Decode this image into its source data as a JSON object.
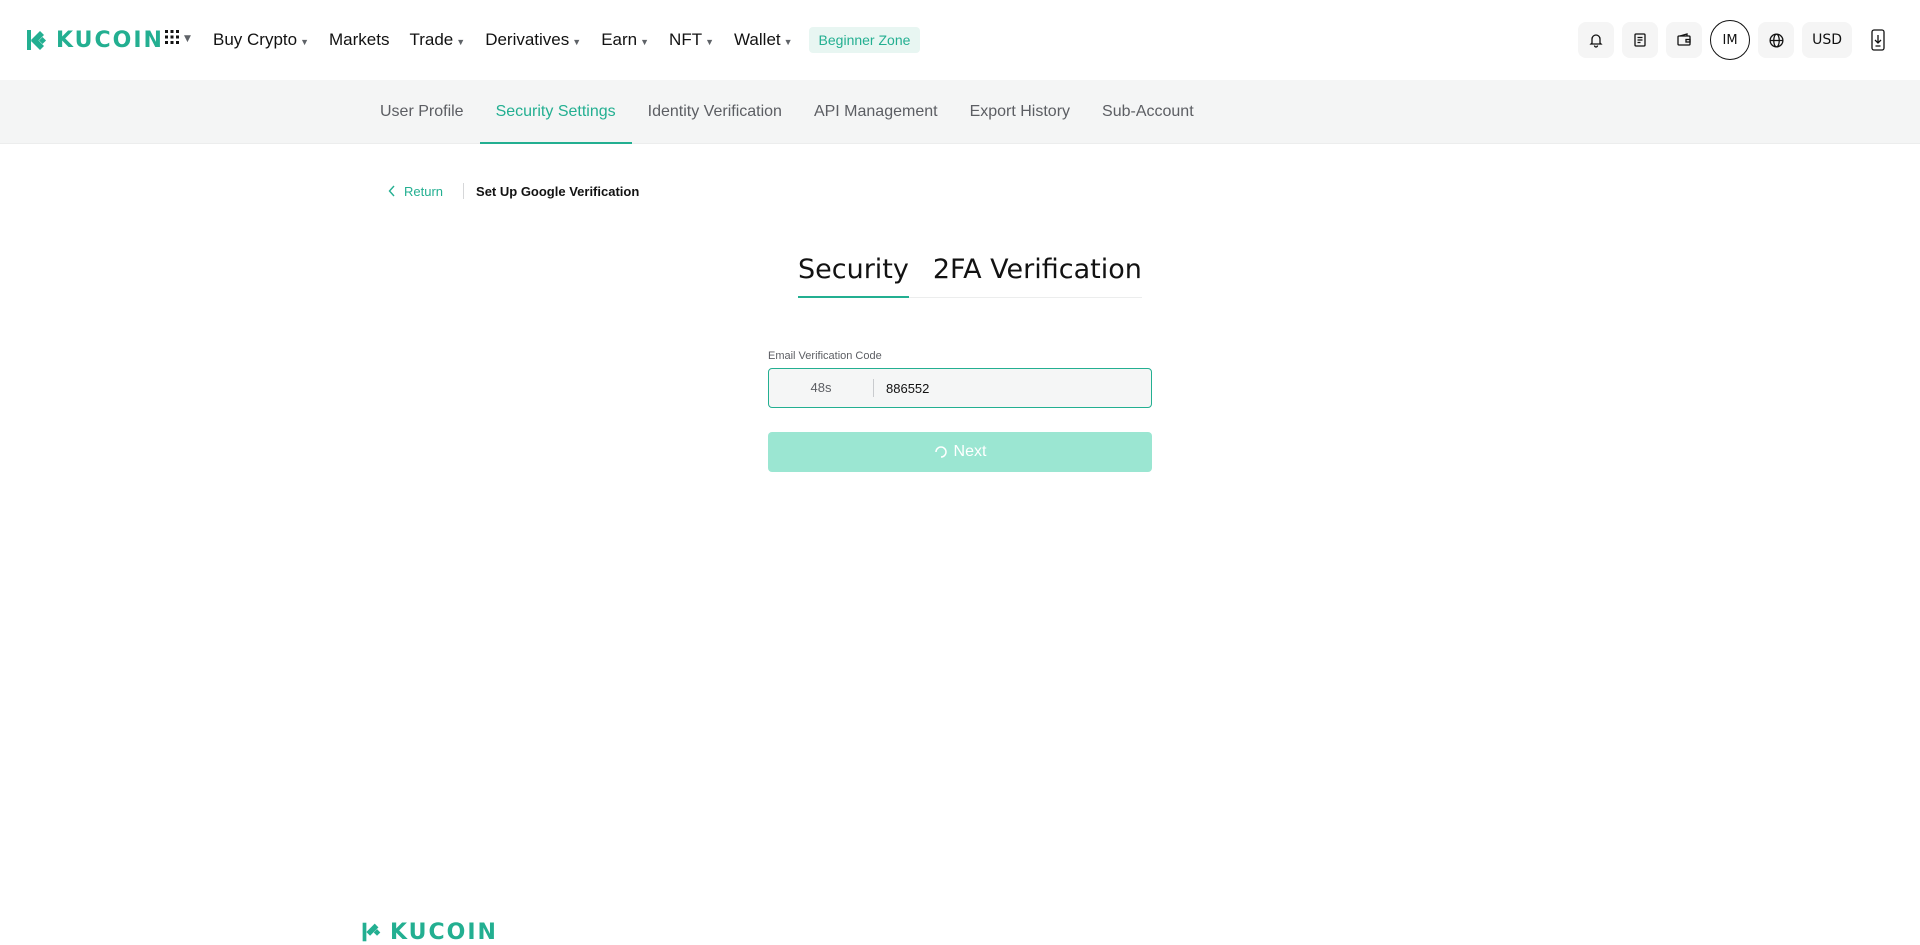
{
  "brand": {
    "name": "KUCOIN",
    "color": "#23af91"
  },
  "header": {
    "apps_icon": "grid-icon",
    "menu": [
      {
        "label": "Buy Crypto",
        "dropdown": true
      },
      {
        "label": "Markets",
        "dropdown": false
      },
      {
        "label": "Trade",
        "dropdown": true
      },
      {
        "label": "Derivatives",
        "dropdown": true
      },
      {
        "label": "Earn",
        "dropdown": true
      },
      {
        "label": "NFT",
        "dropdown": true
      },
      {
        "label": "Wallet",
        "dropdown": true
      }
    ],
    "beginner_zone": "Beginner Zone",
    "right": {
      "notification_icon": "bell-icon",
      "orders_icon": "document-icon",
      "wallet_icon": "wallet-icon",
      "avatar_initials": "IM",
      "language_icon": "globe-icon",
      "currency": "USD",
      "download_icon": "phone-download-icon"
    }
  },
  "subnav": {
    "tabs": [
      {
        "label": "User Profile",
        "active": false
      },
      {
        "label": "Security Settings",
        "active": true
      },
      {
        "label": "Identity Verification",
        "active": false
      },
      {
        "label": "API Management",
        "active": false
      },
      {
        "label": "Export History",
        "active": false
      },
      {
        "label": "Sub-Account",
        "active": false
      }
    ]
  },
  "breadcrumb": {
    "return_label": "Return",
    "current": "Set Up Google Verification"
  },
  "steps": [
    {
      "label": "Security",
      "active": true
    },
    {
      "label": "2FA Verification",
      "active": false
    }
  ],
  "form": {
    "email_code_label": "Email Verification Code",
    "countdown": "48s",
    "code_value": "886552",
    "next_label": "Next",
    "next_loading": true
  },
  "footer": {
    "brand": "KUCOIN"
  }
}
